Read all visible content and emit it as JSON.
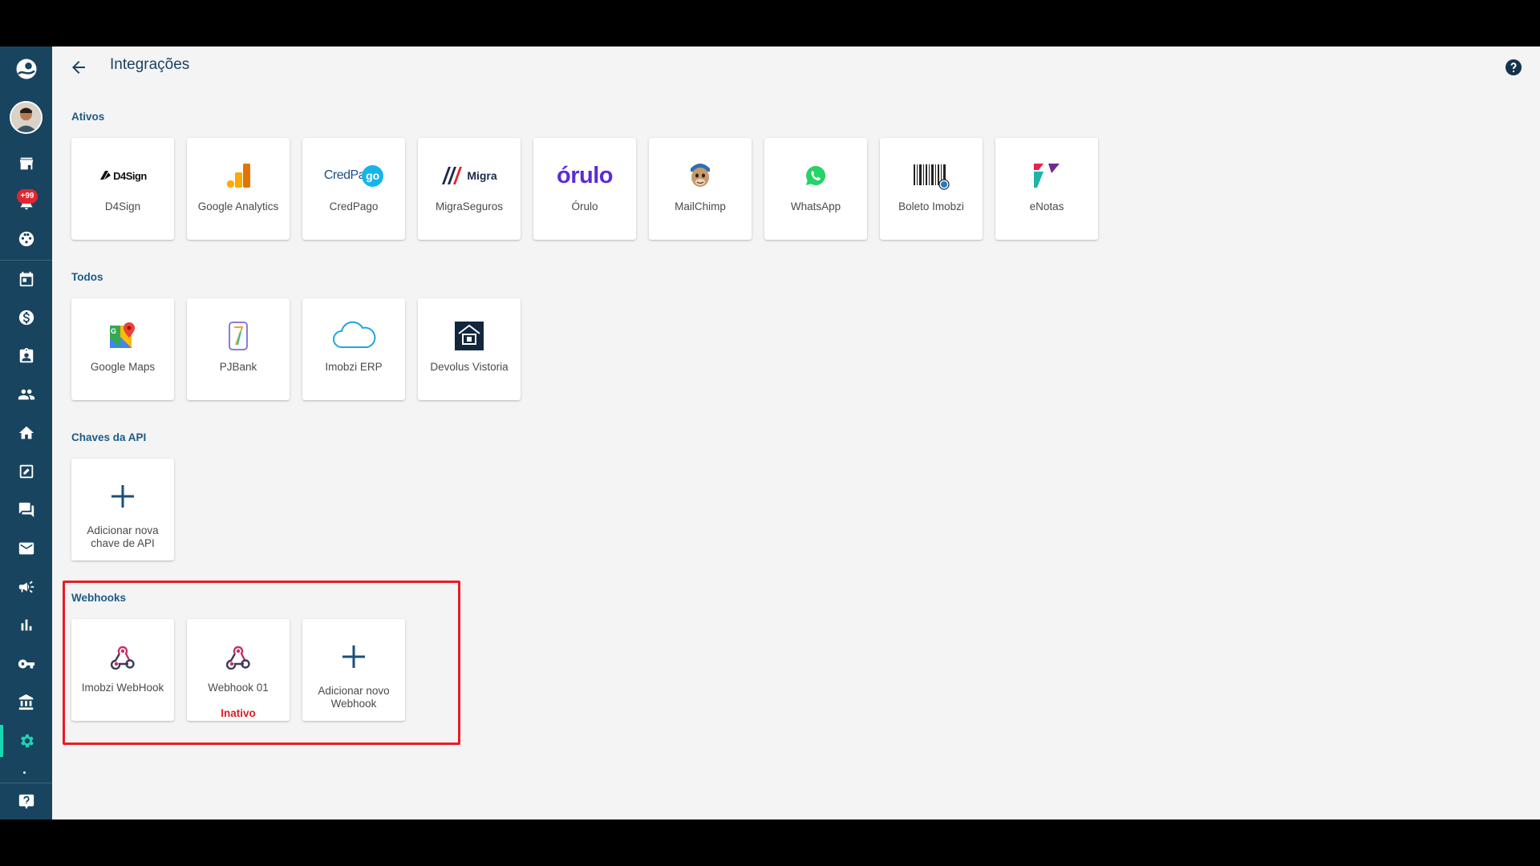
{
  "header": {
    "title": "Integrações"
  },
  "sidebar": {
    "notifications_badge": "+99"
  },
  "sections": {
    "active": {
      "title": "Ativos",
      "items": [
        {
          "label": "D4Sign",
          "logo_text": "D4Sign"
        },
        {
          "label": "Google Analytics"
        },
        {
          "label": "CredPago",
          "logo_text": "CredPa",
          "logo_text_2": "go"
        },
        {
          "label": "MigraSeguros",
          "logo_text": "Migra"
        },
        {
          "label": "Órulo",
          "logo_text": "órulo"
        },
        {
          "label": "MailChimp"
        },
        {
          "label": "WhatsApp"
        },
        {
          "label": "Boleto Imobzi"
        },
        {
          "label": "eNotas"
        }
      ]
    },
    "all": {
      "title": "Todos",
      "items": [
        {
          "label": "Google Maps"
        },
        {
          "label": "PJBank"
        },
        {
          "label": "Imobzi ERP"
        },
        {
          "label": "Devolus Vistoria"
        }
      ]
    },
    "api_keys": {
      "title": "Chaves da API",
      "add_label": "Adicionar nova chave de API"
    },
    "webhooks": {
      "title": "Webhooks",
      "items": [
        {
          "label": "Imobzi WebHook",
          "status": ""
        },
        {
          "label": "Webhook 01",
          "status": "Inativo"
        }
      ],
      "add_label": "Adicionar novo Webhook"
    }
  },
  "colors": {
    "sidebar": "#18445f",
    "accent": "#1fd4b3",
    "title": "#1a425d",
    "section_title": "#1d5a85",
    "inactive": "#e11b22",
    "highlight": "#e81c24"
  }
}
